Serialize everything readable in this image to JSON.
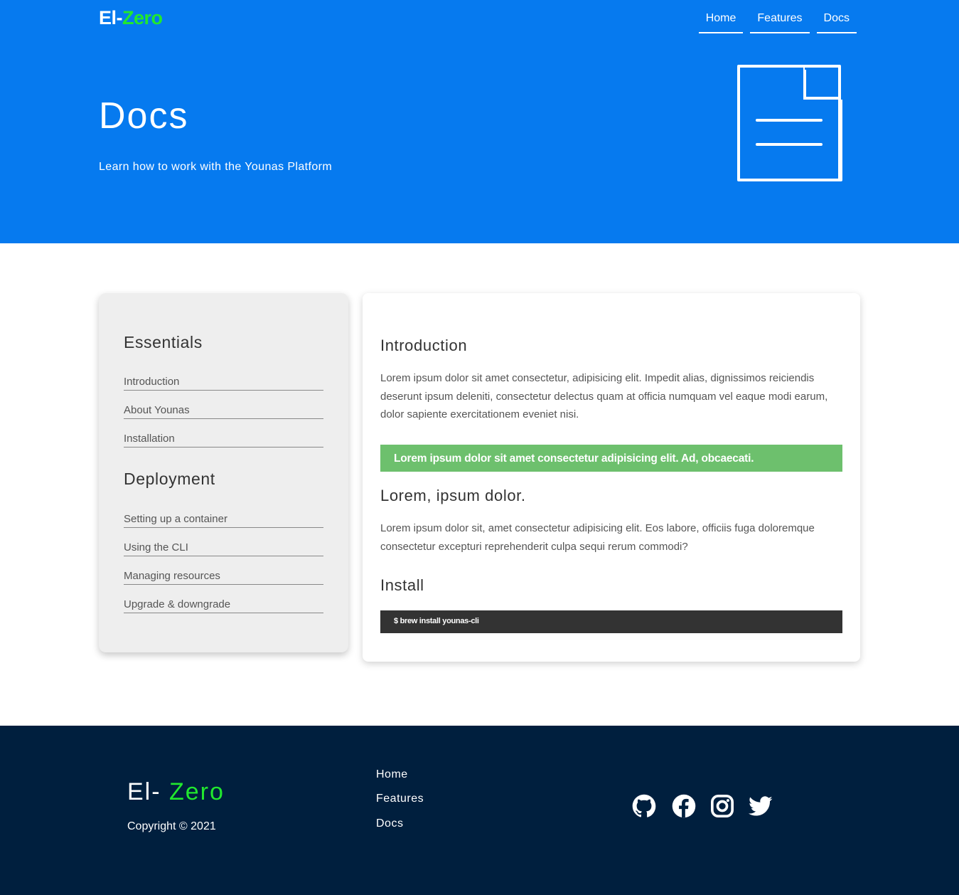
{
  "header": {
    "brand_prefix": "El-",
    "brand_accent": "Zero",
    "nav": [
      {
        "label": "Home"
      },
      {
        "label": "Features"
      },
      {
        "label": "Docs"
      }
    ],
    "title": "Docs",
    "subtitle": "Learn how to work with the Younas Platform",
    "icon": "document-icon",
    "bg_color": "#067aef",
    "accent_color": "#21e82e"
  },
  "sidebar": {
    "sections": [
      {
        "heading": "Essentials",
        "links": [
          "Introduction",
          "About Younas",
          "Installation"
        ]
      },
      {
        "heading": "Deployment",
        "links": [
          "Setting up a container",
          "Using the CLI",
          "Managing resources",
          "Upgrade & downgrade"
        ]
      }
    ]
  },
  "content": {
    "intro_heading": "Introduction",
    "intro_text": "Lorem ipsum dolor sit amet consectetur, adipisicing elit. Impedit alias, dignissimos reiciendis deserunt ipsum deleniti, consectetur delectus quam at officia numquam vel eaque modi earum, dolor sapiente exercitationem eveniet nisi.",
    "note_text": "Lorem ipsum dolor sit amet consectetur adipisicing elit. Ad, obcaecati.",
    "note_color": "#6dc06d",
    "section_heading": "Lorem, ipsum dolor.",
    "section_text": "Lorem ipsum dolor sit, amet consectetur adipisicing elit. Eos labore, officiis fuga doloremque consectetur excepturi reprehenderit culpa sequi rerum commodi?",
    "install_heading": "Install",
    "install_code": "$ brew install younas-cli"
  },
  "footer": {
    "brand_prefix": "El- ",
    "brand_accent": "Zero",
    "copyright": "Copyright © 2021",
    "links": [
      "Home",
      "Features",
      "Docs"
    ],
    "social": [
      "github-icon",
      "facebook-icon",
      "instagram-icon",
      "twitter-icon"
    ],
    "bg_color": "#001f3e"
  }
}
